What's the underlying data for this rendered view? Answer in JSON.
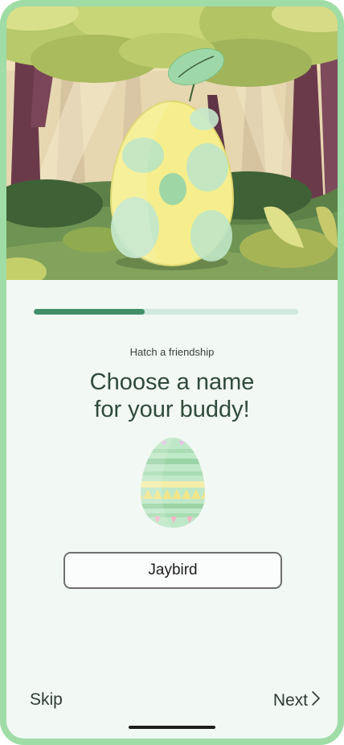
{
  "onboarding": {
    "progress_fraction": 0.42,
    "subtitle": "Hatch a friendship",
    "title_line1": "Choose a name",
    "title_line2": "for your buddy!"
  },
  "name_input": {
    "value": "Jaybird"
  },
  "footer": {
    "skip_label": "Skip",
    "next_label": "Next"
  },
  "colors": {
    "frame": "#9fdca6",
    "progress_fill": "#3f8f6a",
    "progress_track": "#cfe9dc",
    "title_text": "#2f4a3b"
  },
  "icons": {
    "hero": "forest-egg-illustration",
    "small_egg": "striped-egg-icon",
    "next": "chevron-right-icon"
  }
}
